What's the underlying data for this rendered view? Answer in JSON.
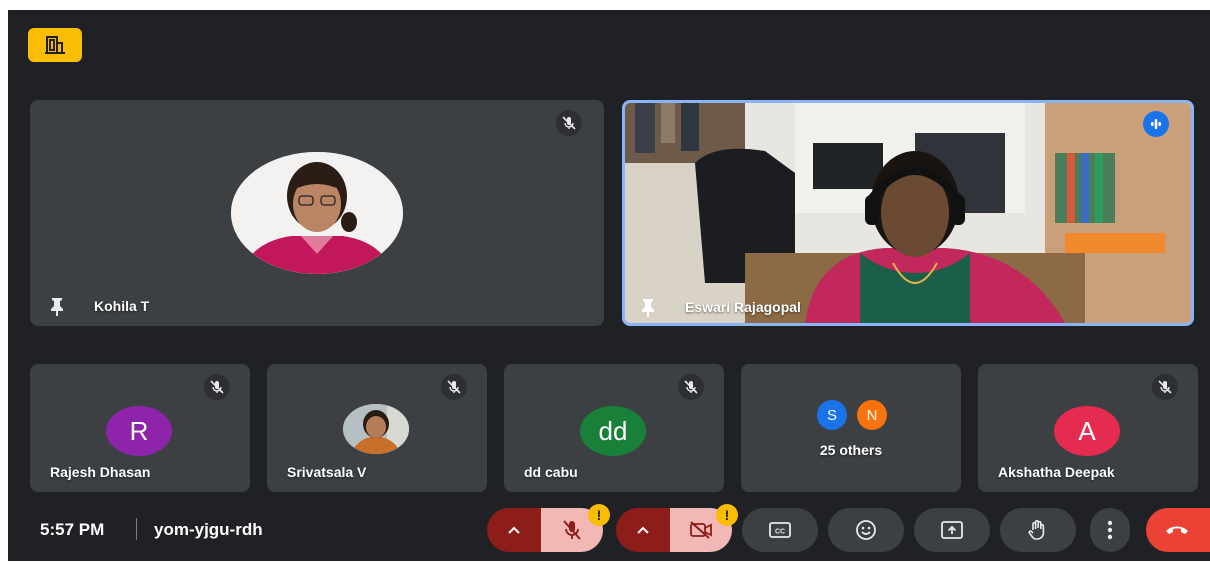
{
  "top": {
    "badge_icon": "meeting-room-icon",
    "badge_color": "#fbbc04"
  },
  "main_tiles": [
    {
      "name": "Kohila T",
      "pinned": true,
      "muted": true
    },
    {
      "name": "Eswari Rajagopal",
      "pinned": true,
      "speaking": true
    }
  ],
  "small_tiles": [
    {
      "name": "Rajesh Dhasan",
      "avatar_letter": "R",
      "avatar_color": "#8e24aa",
      "muted": true
    },
    {
      "name": "Srivatsala V",
      "avatar_photo": true,
      "muted": true
    },
    {
      "name": "dd cabu",
      "avatar_letter": "dd",
      "avatar_color": "#188038",
      "muted": true
    },
    {
      "name": "",
      "others_label": "25 others",
      "mini_avatars": [
        {
          "letter": "S",
          "color": "#1a73e8"
        },
        {
          "letter": "N",
          "color": "#f9730c"
        }
      ]
    },
    {
      "name": "Akshatha Deepak",
      "avatar_letter": "A",
      "avatar_color": "#e52b50",
      "muted": true
    }
  ],
  "bottom_bar": {
    "time": "5:57 PM",
    "meeting_code": "yom-yjgu-rdh",
    "warning_glyph": "!",
    "controls": [
      "mic-options",
      "mic-off",
      "camera-options",
      "camera-off",
      "captions",
      "emoji",
      "present",
      "raise-hand",
      "more-options",
      "leave-call"
    ]
  },
  "colors": {
    "background": "#202124",
    "tile": "#3c4043",
    "active_border": "#8ab4f8",
    "leave": "#ea4335",
    "off_red": "#8c1d18",
    "off_pink": "#f2b8b5"
  }
}
